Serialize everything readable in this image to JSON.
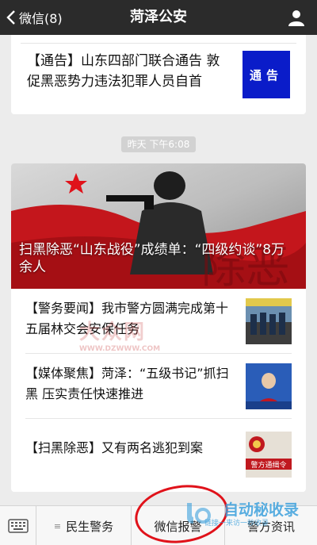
{
  "header": {
    "back_label": "微信(8)",
    "title": "菏泽公安"
  },
  "notice": {
    "text": "【通告】山东四部门联合通告 敦促黑恶势力违法犯罪人员自首",
    "thumb_text": "通告",
    "thumb_color": "#0a1cc9"
  },
  "timestamp": "昨天 下午6:08",
  "article": {
    "cover_title": "扫黑除恶“山东战役”成绩单：“四级约谈”8万余人",
    "items": [
      {
        "text": "【警务要闻】我市警方圆满完成第十五届林交会安保任务"
      },
      {
        "text": "【媒体聚焦】菏泽：“五级书记”抓扫黑 压实责任快速推进"
      },
      {
        "text": "【扫黑除恶】又有两名逃犯到案"
      }
    ],
    "thumb3_text": "警方通缉令"
  },
  "watermark": {
    "text": "大众网",
    "url": "WWW.DZWWW.COM"
  },
  "bottom_menu": {
    "items": [
      "民生警务",
      "微信报警",
      "警方资讯"
    ]
  },
  "brand": {
    "name": "自动秘收录",
    "slogan": "链接一来访一秒收录"
  },
  "colors": {
    "topbar": "#2b2b2b",
    "accent_red": "#e0121a",
    "notice_blue": "#0a1cc9"
  }
}
